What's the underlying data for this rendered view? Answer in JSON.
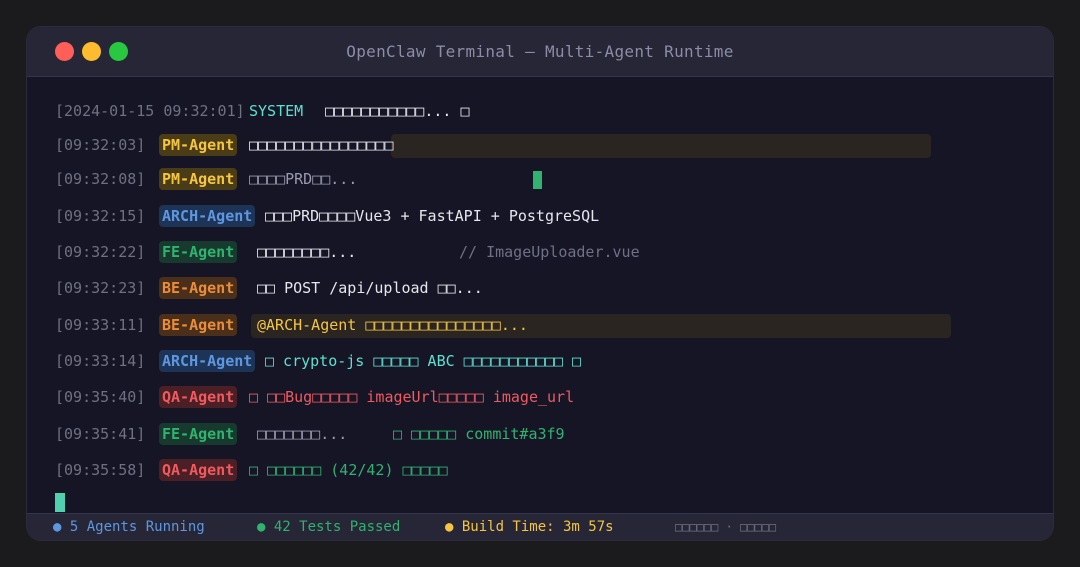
{
  "window": {
    "title": "OpenClaw Terminal — Multi-Agent Runtime"
  },
  "log": [
    {
      "time": "[2024-01-15 09:32:01]",
      "agent": "SYSTEM",
      "message": "□□□□□□□□□□□... □"
    },
    {
      "time": "[09:32:03]",
      "agent": "PM-Agent",
      "message": "□□□□□□□□□□□□□□□□"
    },
    {
      "time": "[09:32:08]",
      "agent": "PM-Agent",
      "message": "□□□□PRD□□..."
    },
    {
      "time": "[09:32:15]",
      "agent": "ARCH-Agent",
      "message": "□□□PRD□□□□Vue3 + FastAPI + PostgreSQL"
    },
    {
      "time": "[09:32:22]",
      "agent": "FE-Agent",
      "message": "□□□□□□□□...",
      "note": "// ImageUploader.vue"
    },
    {
      "time": "[09:32:23]",
      "agent": "BE-Agent",
      "message": "□□ POST /api/upload □□..."
    },
    {
      "time": "[09:33:11]",
      "agent": "BE-Agent",
      "message": "@ARCH-Agent □□□□□□□□□□□□□□□..."
    },
    {
      "time": "[09:33:14]",
      "agent": "ARCH-Agent",
      "message": "□ crypto-js □□□□□ ABC □□□□□□□□□□□ □"
    },
    {
      "time": "[09:35:40]",
      "agent": "QA-Agent",
      "message": "□ □□Bug□□□□□ imageUrl□□□□□ image_url"
    },
    {
      "time": "[09:35:41]",
      "agent": "FE-Agent",
      "message": "□□□□□□□...",
      "note": "□ □□□□□ commit#a3f9"
    },
    {
      "time": "[09:35:58]",
      "agent": "QA-Agent",
      "message": "□ □□□□□□ (42/42) □□□□□"
    }
  ],
  "status": {
    "agents": "● 5 Agents Running",
    "tests": "● 42 Tests Passed",
    "build": "● Build Time: 3m 57s",
    "extra": "□□□□□□ · □□□□□"
  },
  "colors": {
    "system": "#5ee0d0",
    "pm": "#f5c542",
    "arch": "#5d97e0",
    "fe": "#2fb36f",
    "be": "#e98d3b",
    "qa": "#ef5a5f",
    "cursor": "#4fd1b0"
  }
}
